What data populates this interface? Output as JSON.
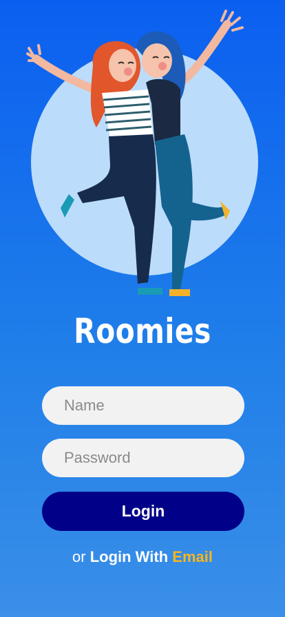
{
  "app": {
    "title": "Roomies"
  },
  "form": {
    "name_placeholder": "Name",
    "password_placeholder": "Password",
    "login_label": "Login"
  },
  "alt_login": {
    "prefix": "or",
    "middle": "Login With",
    "link": "Email"
  },
  "colors": {
    "background_top": "#0b5ff0",
    "background_bottom": "#3a8fe8",
    "hero_circle": "#bcdcfb",
    "button": "#010088",
    "accent_link": "#f6b61e",
    "field": "#f2f2f2"
  },
  "illustration": {
    "subject": "two-friends-hugging-illustration"
  }
}
